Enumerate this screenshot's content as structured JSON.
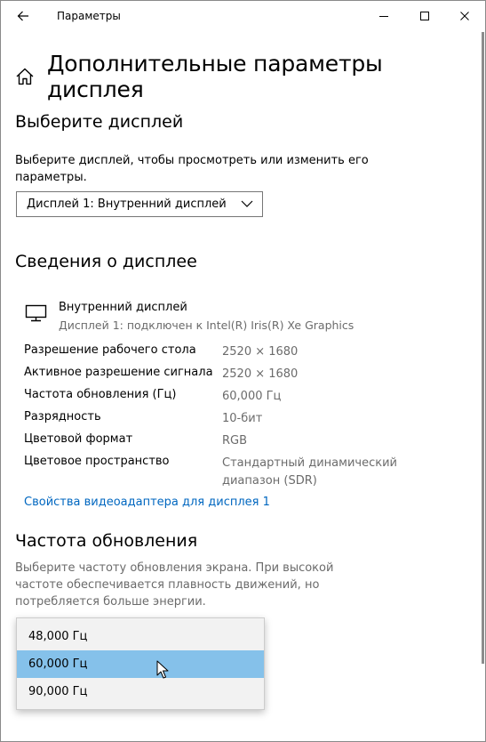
{
  "window": {
    "title": "Параметры"
  },
  "page": {
    "title": "Дополнительные параметры дисплея"
  },
  "select_display": {
    "heading": "Выберите дисплей",
    "description": "Выберите дисплей, чтобы просмотреть или изменить его параметры.",
    "selected": "Дисплей 1: Внутренний дисплей"
  },
  "display_info": {
    "heading": "Сведения о дисплее",
    "name": "Внутренний дисплей",
    "subtitle": "Дисплей 1: подключен к Intel(R) Iris(R) Xe Graphics",
    "rows": [
      {
        "key": "Разрешение рабочего стола",
        "value": "2520 × 1680"
      },
      {
        "key": "Активное разрешение сигнала",
        "value": "2520 × 1680"
      },
      {
        "key": "Частота обновления (Гц)",
        "value": "60,000 Гц"
      },
      {
        "key": "Разрядность",
        "value": "10-бит"
      },
      {
        "key": "Цветовой формат",
        "value": "RGB"
      },
      {
        "key": "Цветовое пространство",
        "value": "Стандартный динамический диапазон (SDR)"
      }
    ],
    "adapter_link": "Свойства видеоадаптера для дисплея 1"
  },
  "refresh_rate": {
    "heading": "Частота обновления",
    "description": "Выберите частоту обновления экрана. При высокой частоте обеспечивается плавность движений, но потребляется больше энергии.",
    "options": [
      "48,000 Гц",
      "60,000 Гц",
      "90,000 Гц"
    ],
    "selected_index": 1
  },
  "colors": {
    "accent_link": "#0067c0",
    "selected_option": "#85c1ea"
  }
}
